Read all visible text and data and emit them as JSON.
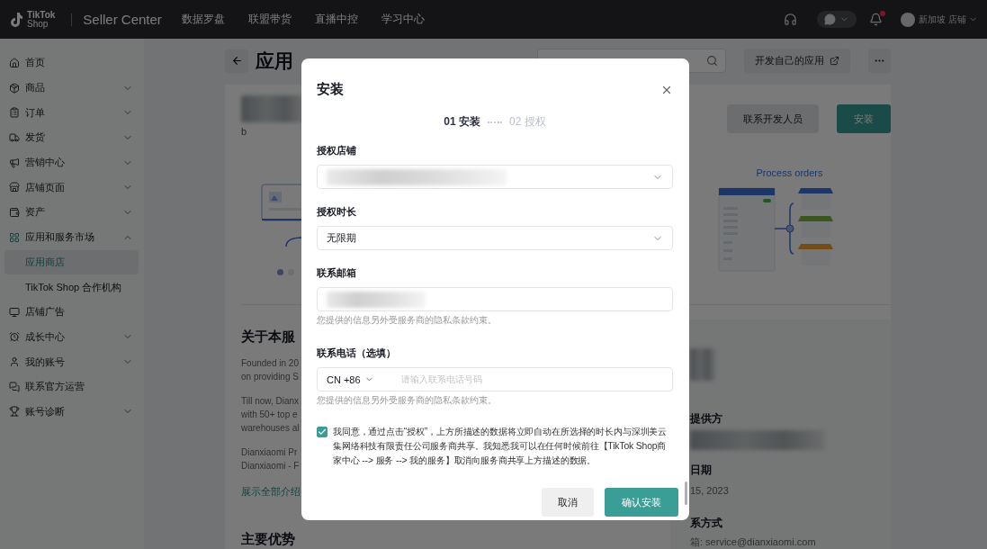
{
  "top_bar": {
    "logo_top": "TikTok",
    "logo_bottom": "Shop",
    "product": "Seller Center",
    "nav": [
      "数据罗盘",
      "联盟带货",
      "直播中控",
      "学习中心"
    ],
    "notification_dot": true,
    "store": "新加坡 店铺"
  },
  "sidebar": {
    "items": [
      {
        "label": "首页"
      },
      {
        "label": "商品",
        "expanded": false
      },
      {
        "label": "订单",
        "expanded": false
      },
      {
        "label": "发货",
        "expanded": false
      },
      {
        "label": "营销中心",
        "expanded": false
      },
      {
        "label": "店铺页面",
        "expanded": false
      },
      {
        "label": "资产",
        "expanded": false
      },
      {
        "label": "应用和服务市场",
        "expanded": true,
        "children": [
          {
            "label": "应用商店",
            "selected": true
          },
          {
            "label": "TikTok Shop 合作机构",
            "selected": false
          }
        ]
      },
      {
        "label": "店铺广告"
      },
      {
        "label": "成长中心",
        "expanded": false
      },
      {
        "label": "我的账号",
        "expanded": false
      },
      {
        "label": "联系官方运营"
      },
      {
        "label": "账号诊断",
        "expanded": false
      }
    ]
  },
  "page": {
    "title": "应用",
    "develop_button": "开发自己的应用",
    "app_subtitle": "b",
    "contact_button": "联系开发人员",
    "install_button": "安装",
    "carousel": {
      "slides": [
        {
          "kind": "picture"
        },
        {
          "kind": "diagram",
          "title": "Process orders"
        }
      ],
      "dots": [
        {
          "selected": true
        },
        {
          "selected": false
        }
      ]
    },
    "about": {
      "heading": "关于本服",
      "paragraphs": [
        [
          "Founded in 20",
          "on providing S"
        ],
        [
          "Till now, Dianx",
          "with 50+ top e",
          "warehouses al"
        ],
        [
          "Dianxiaomi Pr",
          "Dianxiaomi - F"
        ]
      ],
      "more_link": "展示全部介绍",
      "next_heading": "主要优势"
    },
    "info": {
      "provider_label": "提供方",
      "date_label": "日期",
      "date": "15, 2023",
      "contact_label": "系方式",
      "email": "箱: service@dianxiaomi.com"
    }
  },
  "modal": {
    "title": "安装",
    "steps": [
      {
        "label": "01 安装",
        "selected": true
      },
      {
        "label": "02 授权",
        "selected": false
      }
    ],
    "fields": [
      {
        "kind": "select",
        "label": "授权店铺",
        "redacted": true
      },
      {
        "kind": "select",
        "label": "授权时长",
        "value": "无限期"
      },
      {
        "kind": "text",
        "label": "联系邮箱",
        "redacted": true,
        "hint": "您提供的信息另外受服务商的隐私条款约束。"
      },
      {
        "kind": "phone",
        "label": "联系电话（选填）",
        "country": "CN +86",
        "placeholder": "请输入联系电话号码",
        "hint": "您提供的信息另外受服务商的隐私条款约束。"
      }
    ],
    "agreement": {
      "checked": true,
      "text": "我同意，通过点击“授权”，上方所描述的数据将立即自动在所选择的时长内与深圳美云集网络科技有限责任公司服务商共享。我知悉我可以在任何时候前往【TikTok Shop商家中心 --> 服务 --> 我的服务】取消向服务商共享上方描述的数据。"
    },
    "buttons": [
      {
        "label": "取消",
        "kind": "secondary"
      },
      {
        "label": "确认安装",
        "kind": "primary"
      }
    ]
  }
}
